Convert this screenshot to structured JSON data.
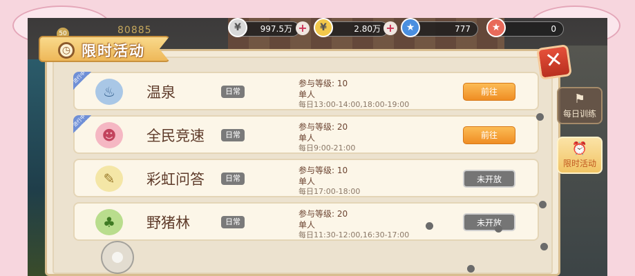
{
  "hud": {
    "player_level": "50",
    "combat_power": "80885",
    "silver": {
      "amount": "997.5万",
      "icon": "silver-coin-icon"
    },
    "gold": {
      "amount": "2.80万",
      "icon": "gold-coin-icon"
    },
    "tickets": {
      "amount": "777",
      "icon": "ticket-icon"
    },
    "event_tokens": {
      "amount": "0",
      "icon": "star-ticket-icon"
    },
    "plus_symbol": "+"
  },
  "panel": {
    "title": "限时活动",
    "title_icon": "alarm-clock-icon",
    "close_symbol": "✕"
  },
  "activities": [
    {
      "name": "温泉",
      "tag": "日常",
      "level": "参与等级: 10",
      "mode": "单人",
      "time": "每日13:00-14:00,18:00-19:00",
      "button": "前往",
      "status": "open",
      "ribbon": "进行中",
      "icon": "hot-spring-icon",
      "icon_glyph": "♨"
    },
    {
      "name": "全民竞速",
      "tag": "日常",
      "level": "参与等级: 20",
      "mode": "单人",
      "time": "每日9:00-21:00",
      "button": "前往",
      "status": "open",
      "ribbon": "进行中",
      "icon": "racer-character-icon",
      "icon_glyph": "☻"
    },
    {
      "name": "彩虹问答",
      "tag": "日常",
      "level": "参与等级: 10",
      "mode": "单人",
      "time": "每日17:00-18:00",
      "button": "未开放",
      "status": "closed",
      "ribbon": "",
      "icon": "scroll-bunny-icon",
      "icon_glyph": "✎"
    },
    {
      "name": "野猪林",
      "tag": "日常",
      "level": "参与等级: 20",
      "mode": "单人",
      "time": "每日11:30-12:00,16:30-17:00",
      "button": "未开放",
      "status": "closed",
      "ribbon": "",
      "icon": "boar-icon",
      "icon_glyph": "♣"
    }
  ],
  "side_menu": [
    {
      "label": "每日训练",
      "icon": "dumbbell-icon",
      "glyph": "⚑"
    },
    {
      "label": "限时活动",
      "icon": "alarm-clock-icon",
      "glyph": "⏰"
    }
  ],
  "colors": {
    "button_open": "#f5a33a",
    "button_closed": "#757575",
    "ribbon": "#6f8fd6"
  }
}
